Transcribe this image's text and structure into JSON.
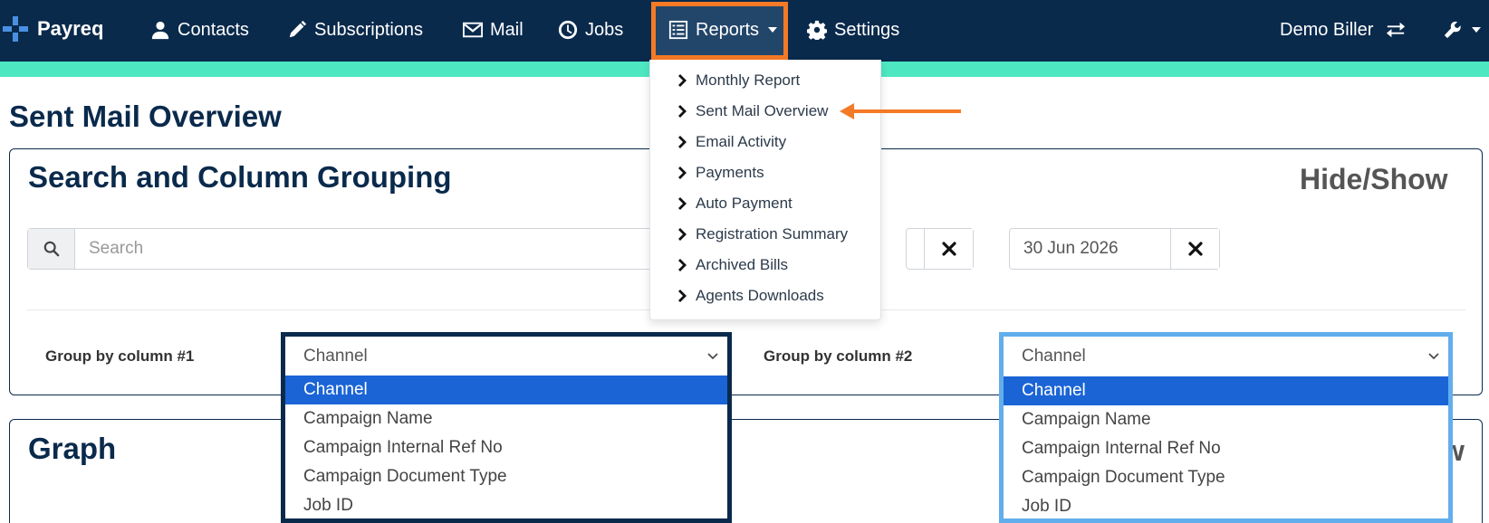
{
  "nav": {
    "brand": "Payreq",
    "items": [
      {
        "label": "Contacts",
        "icon": "user-icon"
      },
      {
        "label": "Subscriptions",
        "icon": "pencil-icon"
      },
      {
        "label": "Mail",
        "icon": "envelope-icon"
      },
      {
        "label": "Jobs",
        "icon": "clock-icon"
      },
      {
        "label": "Reports",
        "icon": "report-list-icon"
      },
      {
        "label": "Settings",
        "icon": "gear-icon"
      }
    ],
    "account": "Demo Biller"
  },
  "reports_menu": {
    "items": [
      "Monthly Report",
      "Sent Mail Overview",
      "Email Activity",
      "Payments",
      "Auto Payment",
      "Registration Summary",
      "Archived Bills",
      "Agents Downloads"
    ],
    "highlighted": "Sent Mail Overview"
  },
  "page": {
    "title": "Sent Mail Overview"
  },
  "search_panel": {
    "title": "Search and Column Grouping",
    "toggle": "Hide/Show",
    "search_placeholder": "Search",
    "end_date": "30 Jun 2026"
  },
  "grouping": {
    "label1": "Group by column #1",
    "label2": "Group by column #2",
    "selected1": "Channel",
    "selected2": "Channel",
    "options": [
      "Channel",
      "Campaign Name",
      "Campaign Internal Ref No",
      "Campaign Document Type",
      "Job ID"
    ]
  },
  "graph_panel": {
    "title": "Graph",
    "toggle_fragment": "w"
  },
  "colors": {
    "navbar": "#0a2a4c",
    "accent_strip": "#4de8c2",
    "highlight_orange": "#f47a26",
    "selected_option": "#1a64d6",
    "frame_light": "#62aeec"
  }
}
